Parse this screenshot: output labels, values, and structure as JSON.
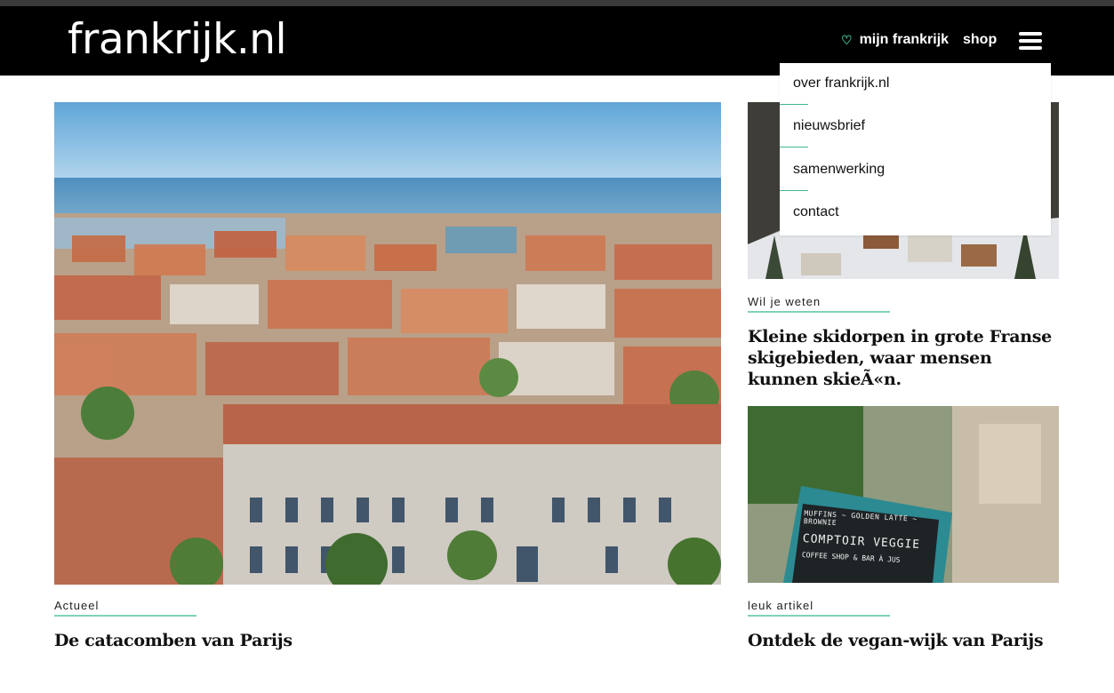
{
  "header": {
    "logo": "frankrijk.nl",
    "fav_label": "mijn frankrijk",
    "shop_label": "shop"
  },
  "menu": {
    "items": [
      "over frankrijk.nl",
      "nieuwsbrief",
      "samenwerking",
      "contact"
    ]
  },
  "articles": {
    "main": {
      "category": "Actueel",
      "title": "De catacomben van Parijs"
    },
    "side1": {
      "category": "Wil je weten",
      "title": "Kleine skidorpen in grote Franse skigebieden, waar mensen kunnen skieÃ«n."
    },
    "side2": {
      "category": "leuk artikel",
      "title": "Ontdek de vegan-wijk van Parijs"
    },
    "chalkboard": {
      "line1": "MUFFINS ~ GOLDEN LATTE ~ BROWNIE",
      "line2": "COMPTOIR VEGGIE",
      "line3": "COFFEE SHOP & BAR À JUS"
    }
  },
  "colors": {
    "accent": "#3dbb8f",
    "header_bg": "#000000"
  }
}
